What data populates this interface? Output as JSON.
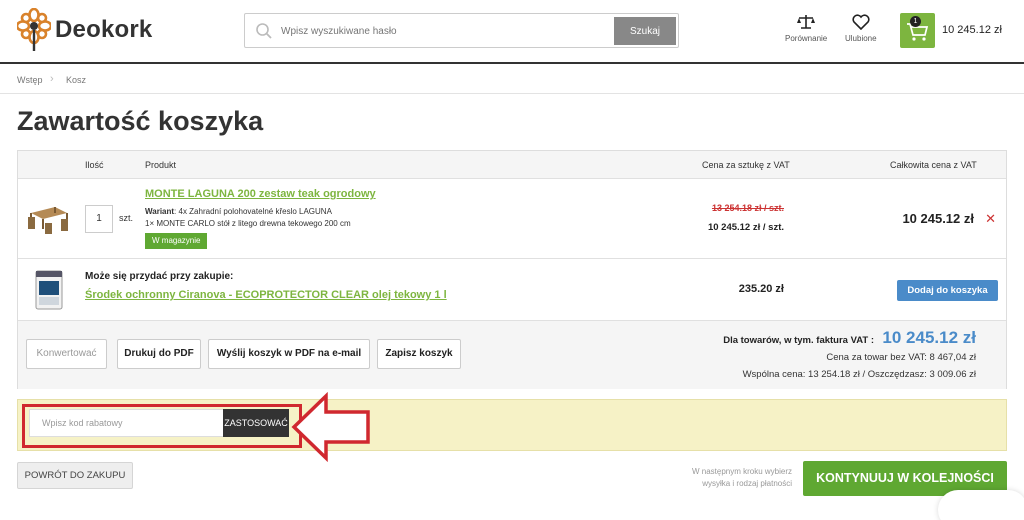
{
  "header": {
    "logo_text": "Deokork",
    "search_placeholder": "Wpisz wyszukiwane hasło",
    "search_button": "Szukaj",
    "compare_label": "Porównanie",
    "favorites_label": "Ulubione",
    "cart_count": "1",
    "cart_total": "10 245.12 zł"
  },
  "breadcrumb": {
    "home": "Wstęp",
    "current": "Kosz"
  },
  "page_title": "Zawartość koszyka",
  "table": {
    "headers": {
      "qty": "Ilość",
      "product": "Produkt",
      "unit_price": "Cena za sztukę z VAT",
      "total": "Całkowita cena z VAT"
    },
    "item": {
      "qty": "1",
      "qty_unit": "szt.",
      "name": "MONTE LAGUNA 200 zestaw teak ogrodowy",
      "variant_label": "Wariant",
      "variant_line1": ": 4x Zahradní polohovatelné křeslo LAGUNA",
      "variant_line2": "1× MONTE CARLO stół z litego drewna tekowego 200 cm",
      "stock": "W magazynie",
      "old_price": "13 254.18 zł / szt.",
      "unit_price": "10 245.12 zł / szt.",
      "total": "10 245.12 zł",
      "remove": "✕"
    },
    "suggestion": {
      "label": "Może się przydać przy zakupie:",
      "name": "Środek ochronny Ciranova - ECOPROTECTOR CLEAR olej tekowy 1 l",
      "price": "235.20 zł",
      "add_button": "Dodaj do koszyka"
    },
    "actions": {
      "convert": "Konwertować",
      "print_pdf": "Drukuj do PDF",
      "email_pdf": "Wyślij koszyk w PDF na e-mail",
      "save": "Zapisz koszyk"
    },
    "summary": {
      "label": "Dla towarów, w tym. faktura VAT :",
      "value": "10 245.12 zł",
      "net": "Cena za towar bez VAT: 8 467,04 zł",
      "savings": "Wspólna cena: 13 254.18 zł / Oszczędzasz: 3 009.06 zł"
    }
  },
  "coupon": {
    "placeholder": "Wpisz kod rabatowy",
    "apply": "ZASTOSOWAĆ"
  },
  "footer": {
    "back": "POWRÓT DO ZAKUPU",
    "note_line1": "W następnym kroku wybierz",
    "note_line2": "wysyłka i rodzaj płatności",
    "continue": "KONTYNUUJ W KOLEJNOŚCI"
  },
  "colors": {
    "accent_green": "#7db53f",
    "button_green": "#5fa832",
    "accent_blue": "#4a8bc9",
    "highlight_red": "#d0282f",
    "coupon_bg": "#f6f2c6"
  },
  "icons": {
    "logo": "flower-logo-icon",
    "search": "search-icon",
    "compare": "scales-icon",
    "favorites": "heart-icon",
    "cart": "cart-icon",
    "breadcrumb_sep": "chevron-right-icon",
    "remove": "close-icon",
    "annotation": "arrow-left-icon"
  }
}
